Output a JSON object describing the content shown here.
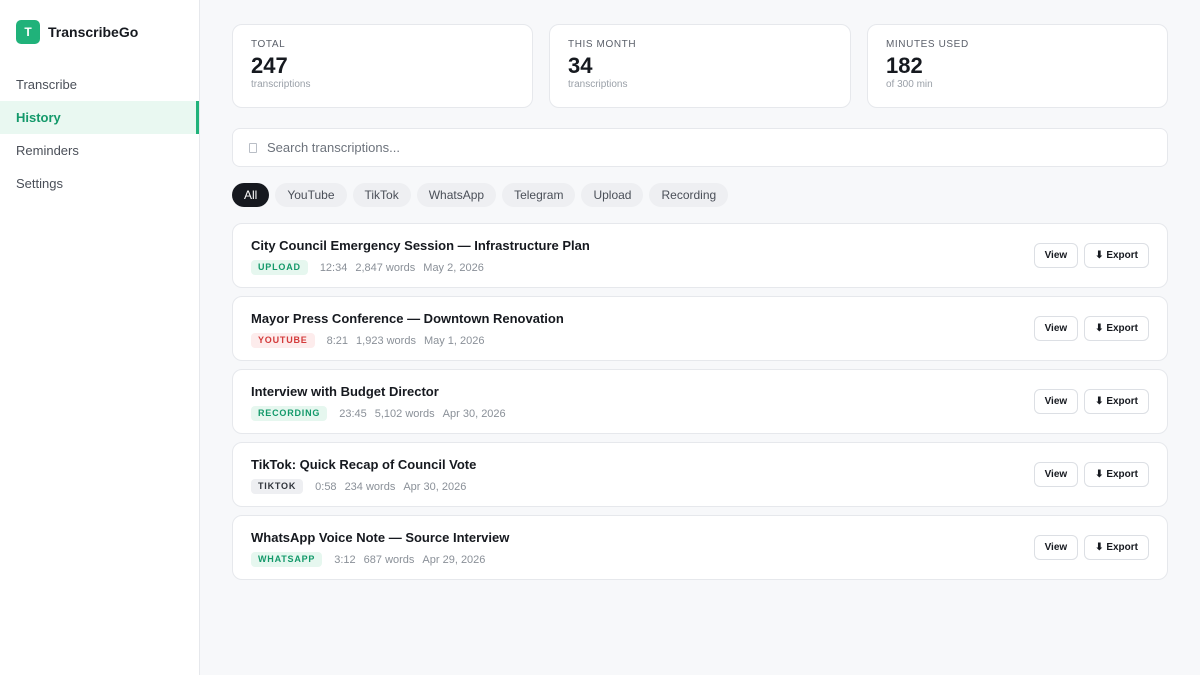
{
  "app": {
    "logo_letter": "T",
    "name": "TranscribeGo"
  },
  "sidebar": {
    "items": [
      {
        "label": "Transcribe",
        "active": false
      },
      {
        "label": "History",
        "active": true
      },
      {
        "label": "Reminders",
        "active": false
      },
      {
        "label": "Settings",
        "active": false
      }
    ]
  },
  "stats": [
    {
      "label": "TOTAL",
      "value": "247",
      "sub": "transcriptions"
    },
    {
      "label": "THIS MONTH",
      "value": "34",
      "sub": "transcriptions"
    },
    {
      "label": "MINUTES USED",
      "value": "182",
      "sub": "of 300 min"
    }
  ],
  "search": {
    "placeholder": "Search transcriptions..."
  },
  "filters": [
    "All",
    "YouTube",
    "TikTok",
    "WhatsApp",
    "Telegram",
    "Upload",
    "Recording"
  ],
  "active_filter": "All",
  "actions": {
    "view": "View",
    "export": "⬇ Export"
  },
  "transcriptions": [
    {
      "title": "City Council Emergency Session — Infrastructure Plan",
      "source": "UPLOAD",
      "duration": "12:34",
      "words": "2,847 words",
      "date": "May 2, 2026"
    },
    {
      "title": "Mayor Press Conference — Downtown Renovation",
      "source": "YOUTUBE",
      "duration": "8:21",
      "words": "1,923 words",
      "date": "May 1, 2026"
    },
    {
      "title": "Interview with Budget Director",
      "source": "RECORDING",
      "duration": "23:45",
      "words": "5,102 words",
      "date": "Apr 30, 2026"
    },
    {
      "title": "TikTok: Quick Recap of Council Vote",
      "source": "TIKTOK",
      "duration": "0:58",
      "words": "234 words",
      "date": "Apr 30, 2026"
    },
    {
      "title": "WhatsApp Voice Note — Source Interview",
      "source": "WHATSAPP",
      "duration": "3:12",
      "words": "687 words",
      "date": "Apr 29, 2026"
    }
  ],
  "colors": {
    "accent": "#20b27a",
    "youtube": "#d33a3a",
    "dark": "#16191f"
  }
}
